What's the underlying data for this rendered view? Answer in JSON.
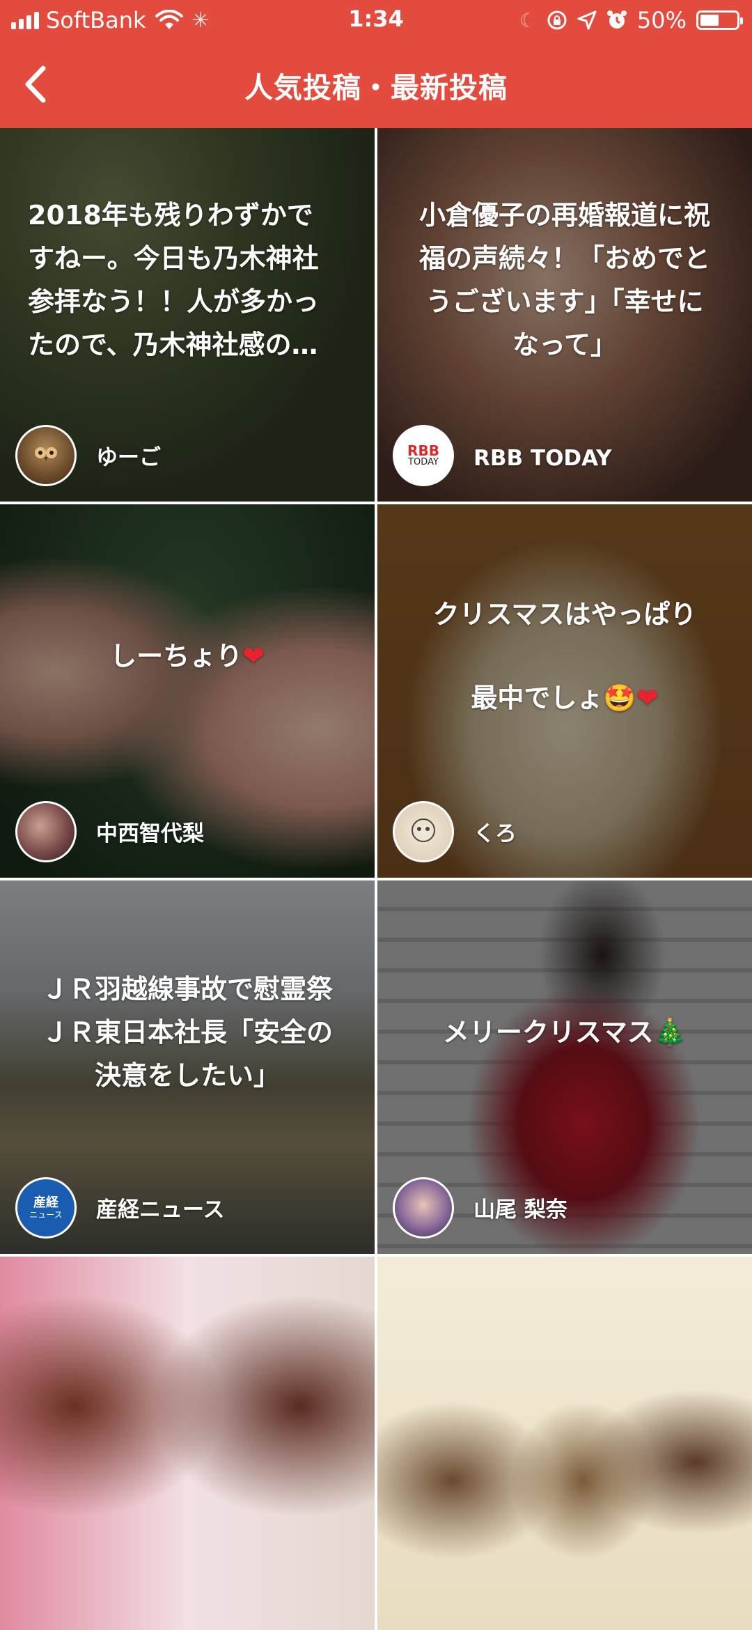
{
  "status_bar": {
    "carrier": "SoftBank",
    "time": "1:34",
    "battery_percent": "50%",
    "battery_level": 0.5,
    "icons": [
      "signal-icon",
      "wifi-icon",
      "activity-spinner-icon",
      "moon-icon",
      "rotation-lock-icon",
      "location-icon",
      "alarm-icon",
      "battery-icon"
    ]
  },
  "header": {
    "back_icon": "chevron-left-icon",
    "title": "人気投稿・最新投稿"
  },
  "posts": [
    {
      "text": "2018年も残りわずかで\nすねー。今日も乃木神社\n参拝なう！！人が多かっ\nたので、乃木神社感の…",
      "author": "ゆーご",
      "avatar": "owl-avatar",
      "align": "left"
    },
    {
      "text": "小倉優子の再婚報道に祝\n福の声続々！「おめでと\nうございます」「幸せに\nなって」",
      "author": "RBB TODAY",
      "avatar": "rbb-today-logo",
      "avatar_text": [
        "RBB",
        "TODAY"
      ],
      "align": "center"
    },
    {
      "text": "しーちょり",
      "emoji": "❤",
      "author": "中西智代梨",
      "avatar": "user-photo-avatar",
      "align": "center"
    },
    {
      "text": "クリスマスはやっぱり\n最中でしょ",
      "emoji": "🤩❤",
      "author": "くろ",
      "avatar": "illustration-avatar",
      "align": "center"
    },
    {
      "text": "ＪＲ羽越線事故で慰霊祭\nＪＲ東日本社長「安全の\n決意をしたい」",
      "author": "産経ニュース",
      "avatar": "sankei-news-logo",
      "avatar_text": [
        "産経",
        "ニュース"
      ],
      "align": "center"
    },
    {
      "text": "メリークリスマス",
      "emoji": "🎄",
      "author": "山尾 梨奈",
      "avatar": "user-photo-avatar",
      "align": "center"
    }
  ],
  "colors": {
    "brand": "#e24b3d",
    "overlay": "rgba(0,0,0,0.38)"
  }
}
